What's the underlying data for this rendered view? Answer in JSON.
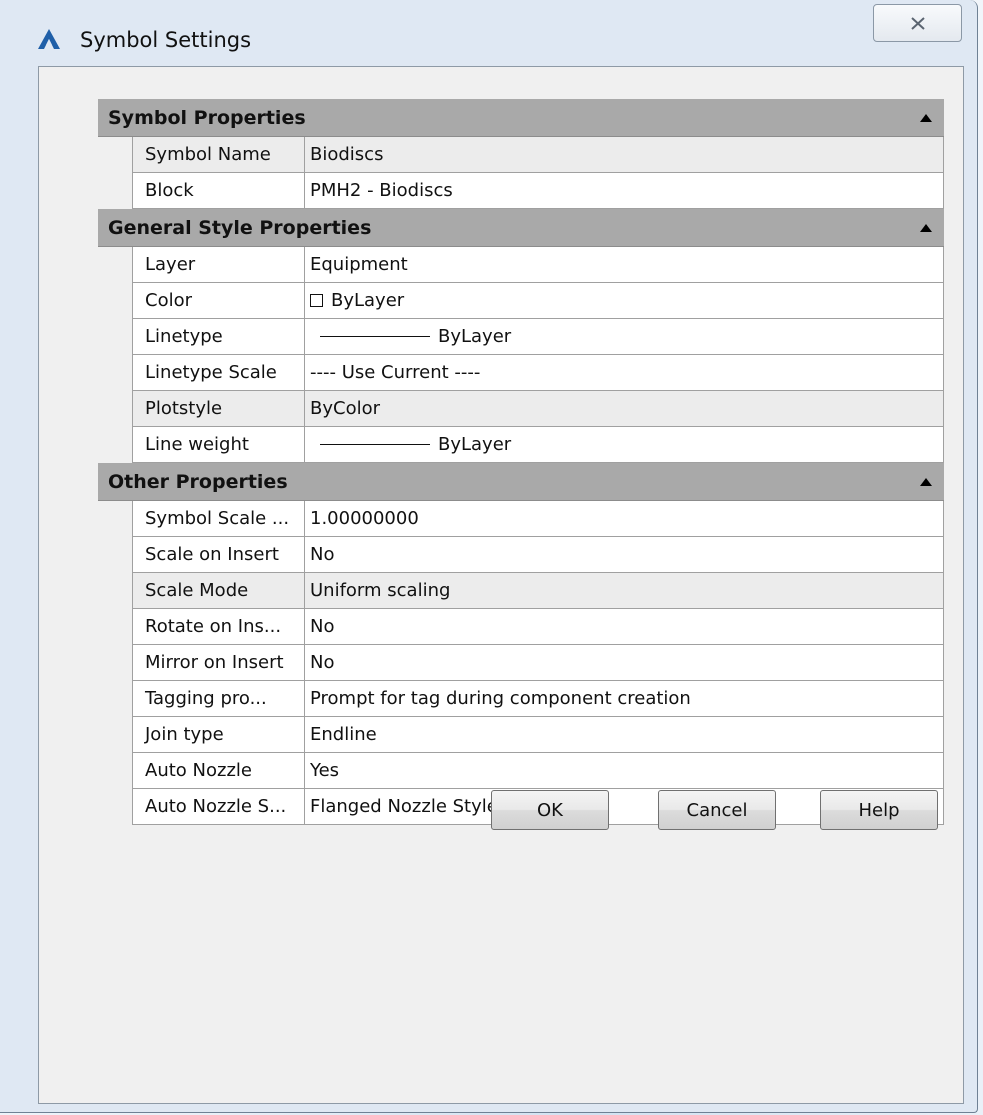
{
  "window": {
    "title": "Symbol Settings",
    "icon": "autocad-logo-icon",
    "close_glyph": "close-icon"
  },
  "colors": {
    "category_header": "#a9a9a9",
    "row_alt": "#ececec",
    "app_icon_blue": "#1f5fa8"
  },
  "grid": {
    "categories": [
      {
        "label": "Symbol Properties",
        "rows": [
          {
            "name": "Symbol Name",
            "value": "Biodiscs"
          },
          {
            "name": "Block",
            "value": "PMH2 - Biodiscs"
          }
        ]
      },
      {
        "label": "General Style Properties",
        "rows": [
          {
            "name": "Layer",
            "value": "Equipment"
          },
          {
            "name": "Color",
            "value": "ByLayer"
          },
          {
            "name": "Linetype",
            "value": "ByLayer"
          },
          {
            "name": "Linetype Scale",
            "value": "---- Use Current ----"
          },
          {
            "name": "Plotstyle",
            "value": "ByColor"
          },
          {
            "name": "Line weight",
            "value": "ByLayer"
          }
        ]
      },
      {
        "label": "Other Properties",
        "rows": [
          {
            "name": "Symbol Scale ...",
            "value": "1.00000000"
          },
          {
            "name": "Scale on Insert",
            "value": "No"
          },
          {
            "name": "Scale Mode",
            "value": "Uniform scaling"
          },
          {
            "name": "Rotate on Ins...",
            "value": "No"
          },
          {
            "name": "Mirror on Insert",
            "value": "No"
          },
          {
            "name": "Tagging pro...",
            "value": "Prompt for tag during component creation"
          },
          {
            "name": "Join type",
            "value": "Endline"
          },
          {
            "name": "Auto Nozzle",
            "value": "Yes"
          },
          {
            "name": "Auto Nozzle S...",
            "value": "Flanged Nozzle Style"
          }
        ]
      }
    ]
  },
  "buttons": {
    "ok": "OK",
    "cancel": "Cancel",
    "help": "Help"
  }
}
